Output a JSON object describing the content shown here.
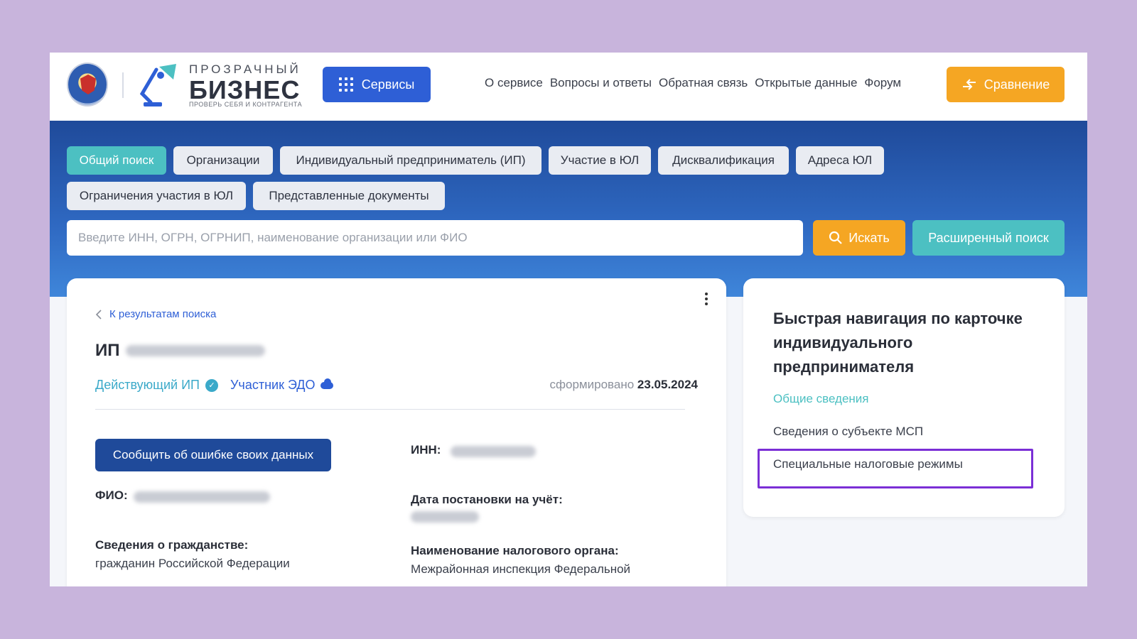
{
  "header": {
    "logo_top": "ПРОЗРАЧНЫЙ",
    "logo_main": "БИЗНЕС",
    "logo_sub": "ПРОВЕРЬ СЕБЯ И КОНТРАГЕНТА",
    "services_label": "Сервисы",
    "nav": [
      "О сервисе",
      "Вопросы и ответы",
      "Обратная связь",
      "Открытые данные",
      "Форум"
    ],
    "compare_label": "Сравнение"
  },
  "tabs": {
    "row1": [
      "Общий поиск",
      "Организации",
      "Индивидуальный предприниматель (ИП)",
      "Участие в ЮЛ",
      "Дисквалификация",
      "Адреса ЮЛ"
    ],
    "row2": [
      "Ограничения участия в ЮЛ",
      "Представленные документы"
    ]
  },
  "search": {
    "placeholder": "Введите ИНН, ОГРН, ОГРНИП, наименование организации или ФИО",
    "button_label": "Искать",
    "advanced_label": "Расширенный поиск"
  },
  "card": {
    "back_label": "К результатам поиска",
    "title_prefix": "ИП",
    "status_active": "Действующий ИП",
    "status_edo": "Участник ЭДО",
    "formed_label": "сформировано",
    "formed_date": "23.05.2024",
    "report_button": "Сообщить об ошибке своих данных",
    "fio_label": "ФИО:",
    "citizenship_label": "Сведения о гражданстве:",
    "citizenship_value": "гражданин Российской Федерации",
    "inn_label": "ИНН:",
    "registration_label": "Дата постановки на учёт:",
    "tax_org_label": "Наименование налогового органа:",
    "tax_org_value": "Межрайонная инспекция Федеральной"
  },
  "side": {
    "title": "Быстрая навигация по карточке индивидуального предпринимателя",
    "links": [
      "Общие сведения",
      "Сведения о субъекте МСП",
      "Специальные налоговые режимы"
    ]
  },
  "colors": {
    "accent_blue": "#2e5fd6",
    "accent_orange": "#f5a623",
    "accent_teal": "#4cc0c2",
    "highlight": "#7b2fd6"
  }
}
